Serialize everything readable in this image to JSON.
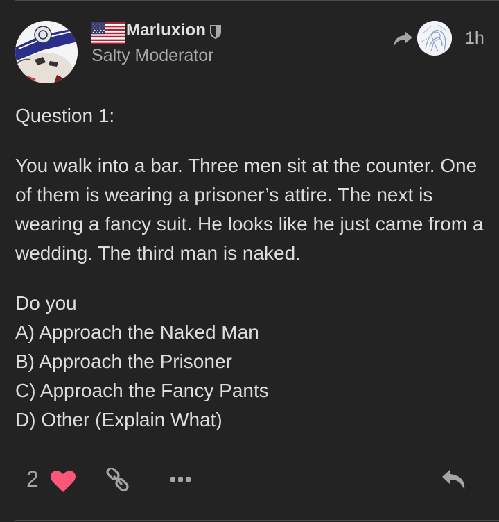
{
  "author": {
    "name": "Marluxion",
    "title": "Salty Moderator",
    "flag": "us-flag-icon",
    "badge": "shield-icon"
  },
  "meta": {
    "time": "1h"
  },
  "post": {
    "heading": "Question 1:",
    "paragraph": "You walk into a bar. Three men sit at the counter. One of them is wearing a prisoner’s attire. The next is wearing a fancy suit. He looks like he just came from a wedding. The third man is naked.",
    "prompt": "Do you",
    "options": [
      "A) Approach the Naked Man",
      "B) Approach the Prisoner",
      "C) Approach the Fancy Pants",
      "D) Other (Explain What)"
    ]
  },
  "actions": {
    "like_count": "2",
    "icons": [
      "heart-icon",
      "link-icon",
      "more-icon",
      "reply-icon"
    ]
  },
  "colors": {
    "background": "#232323",
    "text": "#dddddd",
    "muted": "#a9a9a9",
    "heart": "#fb5779"
  }
}
